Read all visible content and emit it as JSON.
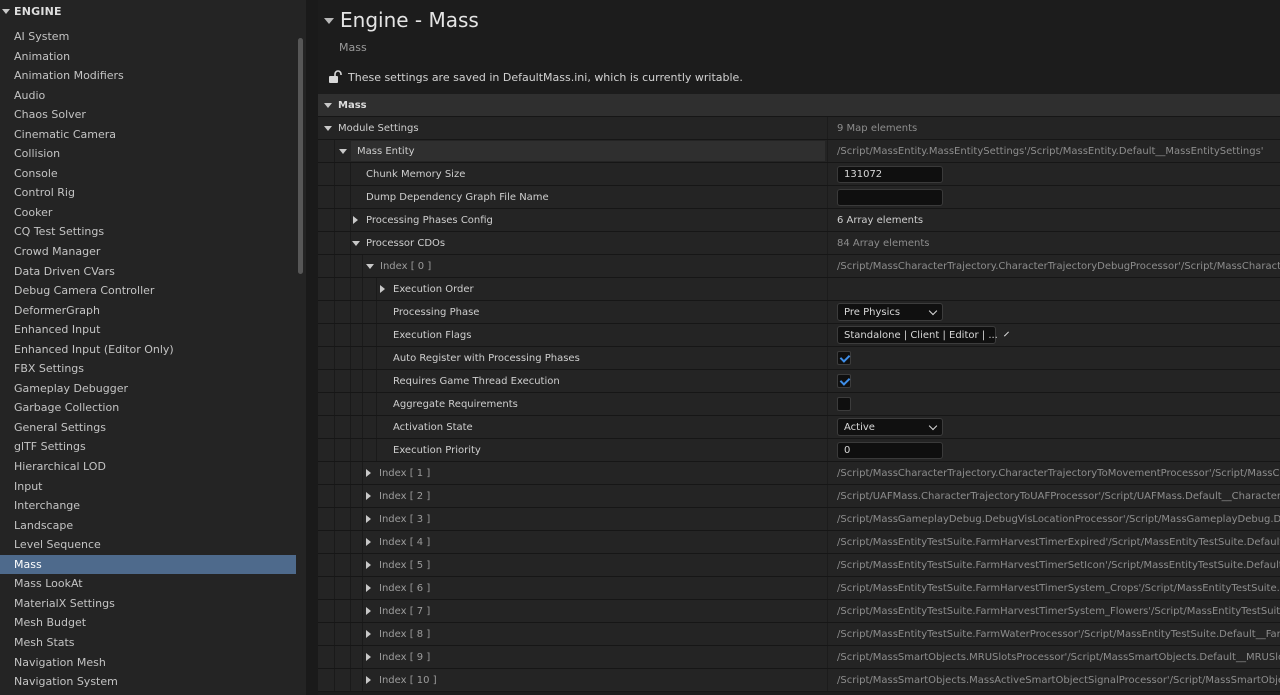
{
  "sidebar": {
    "section_label": "ENGINE",
    "items": [
      "AI System",
      "Animation",
      "Animation Modifiers",
      "Audio",
      "Chaos Solver",
      "Cinematic Camera",
      "Collision",
      "Console",
      "Control Rig",
      "Cooker",
      "CQ Test Settings",
      "Crowd Manager",
      "Data Driven CVars",
      "Debug Camera Controller",
      "DeformerGraph",
      "Enhanced Input",
      "Enhanced Input (Editor Only)",
      "FBX Settings",
      "Gameplay Debugger",
      "Garbage Collection",
      "General Settings",
      "glTF Settings",
      "Hierarchical LOD",
      "Input",
      "Interchange",
      "Landscape",
      "Level Sequence",
      "Mass",
      "Mass LookAt",
      "MaterialX Settings",
      "Mesh Budget",
      "Mesh Stats",
      "Navigation Mesh",
      "Navigation System"
    ],
    "selected": "Mass"
  },
  "header": {
    "title": "Engine - Mass",
    "subtitle": "Mass",
    "info_text": "These settings are saved in DefaultMass.ini, which is currently writable.",
    "info_icon": "unlocked-padlock-icon"
  },
  "grid": {
    "category": "Mass",
    "module_settings": {
      "label": "Module Settings",
      "value": "9 Map elements"
    },
    "mass_entity": {
      "label": "Mass Entity",
      "value": "/Script/MassEntity.MassEntitySettings'/Script/MassEntity.Default__MassEntitySettings'"
    },
    "chunk_memory": {
      "label": "Chunk Memory Size",
      "value": "131072"
    },
    "dump_graph": {
      "label": "Dump Dependency Graph File Name",
      "value": ""
    },
    "phases_config": {
      "label": "Processing Phases Config",
      "value": "6 Array elements"
    },
    "processor_cdos": {
      "label": "Processor CDOs",
      "value": "84 Array elements"
    },
    "index0": {
      "label": "Index [ 0 ]",
      "value": "/Script/MassCharacterTrajectory.CharacterTrajectoryDebugProcessor'/Script/MassCharacterTrajectory.Default__CharacterTrajectoryDebugProcessor'",
      "execution_order": "Execution Order",
      "processing_phase": {
        "label": "Processing Phase",
        "value": "Pre Physics"
      },
      "execution_flags": {
        "label": "Execution Flags",
        "value": "Standalone | Client | Editor | ..."
      },
      "auto_register": {
        "label": "Auto Register with Processing Phases",
        "checked": true
      },
      "game_thread": {
        "label": "Requires Game Thread Execution",
        "checked": true
      },
      "aggregate": {
        "label": "Aggregate Requirements",
        "checked": false
      },
      "activation_state": {
        "label": "Activation State",
        "value": "Active"
      },
      "execution_priority": {
        "label": "Execution Priority",
        "value": "0"
      }
    },
    "indices": [
      {
        "label": "Index [ 1 ]",
        "value": "/Script/MassCharacterTrajectory.CharacterTrajectoryToMovementProcessor'/Script/MassCharacterTrajectory.Default__CharacterTrajectoryToMovementProcessor'"
      },
      {
        "label": "Index [ 2 ]",
        "value": "/Script/UAFMass.CharacterTrajectoryToUAFProcessor'/Script/UAFMass.Default__CharacterTrajectoryToUAFProcessor'"
      },
      {
        "label": "Index [ 3 ]",
        "value": "/Script/MassGameplayDebug.DebugVisLocationProcessor'/Script/MassGameplayDebug.Default__DebugVisLocationProcessor'"
      },
      {
        "label": "Index [ 4 ]",
        "value": "/Script/MassEntityTestSuite.FarmHarvestTimerExpired'/Script/MassEntityTestSuite.Default__FarmHarvestTimerExpired'"
      },
      {
        "label": "Index [ 5 ]",
        "value": "/Script/MassEntityTestSuite.FarmHarvestTimerSetIcon'/Script/MassEntityTestSuite.Default__FarmHarvestTimerSetIcon'"
      },
      {
        "label": "Index [ 6 ]",
        "value": "/Script/MassEntityTestSuite.FarmHarvestTimerSystem_Crops'/Script/MassEntityTestSuite.Default__FarmHarvestTimerSystem_Crops'"
      },
      {
        "label": "Index [ 7 ]",
        "value": "/Script/MassEntityTestSuite.FarmHarvestTimerSystem_Flowers'/Script/MassEntityTestSuite.Default__FarmHarvestTimerSystem_Flowers'"
      },
      {
        "label": "Index [ 8 ]",
        "value": "/Script/MassEntityTestSuite.FarmWaterProcessor'/Script/MassEntityTestSuite.Default__FarmWaterProcessor'"
      },
      {
        "label": "Index [ 9 ]",
        "value": "/Script/MassSmartObjects.MRUSlotsProcessor'/Script/MassSmartObjects.Default__MRUSlotsProcessor'"
      },
      {
        "label": "Index [ 10 ]",
        "value": "/Script/MassSmartObjects.MassActiveSmartObjectSignalProcessor'/Script/MassSmartObjects.Default__MassActiveSmartObjectSignalProcessor'"
      }
    ]
  }
}
